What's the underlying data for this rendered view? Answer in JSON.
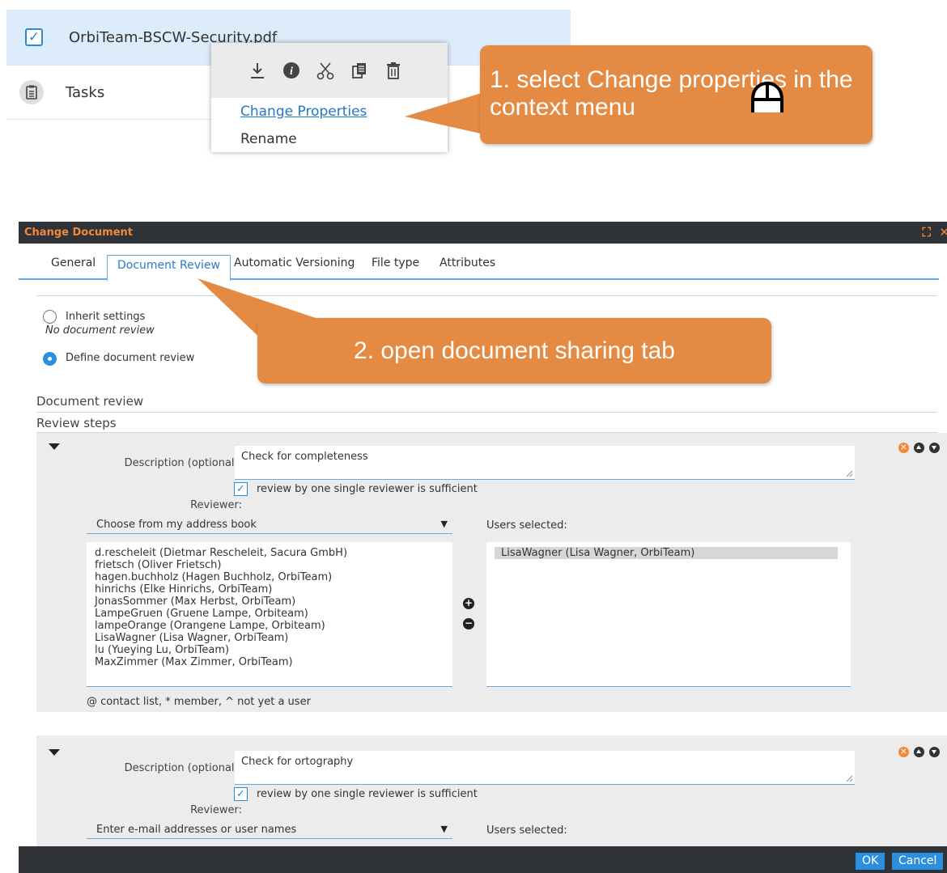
{
  "file_list": {
    "selected_file": "OrbiTeam-BSCW-Security.pdf",
    "second_item": "Tasks"
  },
  "context_menu": {
    "icons": [
      "download-icon",
      "info-icon",
      "cut-icon",
      "copy-icon",
      "trash-icon"
    ],
    "items": [
      "Change Properties",
      "Rename"
    ]
  },
  "callouts": {
    "step1": "1. select Change properties in the context menu",
    "step2": "2. open document sharing tab"
  },
  "dialog": {
    "title": "Change Document",
    "tabs": [
      "General",
      "Document Review",
      "Automatic Versioning",
      "File type",
      "Attributes"
    ],
    "active_tab": "Document Review",
    "inherit_label": "Inherit settings",
    "inherit_sub": "No document review",
    "define_label": "Define document review",
    "section_title": "Document review",
    "steps_title": "Review steps",
    "description_label": "Description (optional):",
    "reviewer_label": "Reviewer:",
    "single_reviewer_label": "review by one single reviewer is sufficient",
    "users_selected_label": "Users selected:",
    "legend": "@ contact list, * member, ^ not yet a user",
    "ok": "OK",
    "cancel": "Cancel"
  },
  "steps": [
    {
      "description": "Check for completeness",
      "single_reviewer": true,
      "reviewer_source": "Choose from my address book",
      "address_book": [
        "d.rescheleit (Dietmar Rescheleit, Sacura GmbH)",
        "frietsch (Oliver Frietsch)",
        "hagen.buchholz (Hagen Buchholz, OrbiTeam)",
        "hinrichs (Elke Hinrichs, OrbiTeam)",
        "JonasSommer (Max Herbst, OrbiTeam)",
        "LampeGruen (Gruene Lampe, Orbiteam)",
        "lampeOrange (Orangene Lampe, Orbiteam)",
        "LisaWagner (Lisa Wagner, OrbiTeam)",
        "lu (Yueying Lu, OrbiTeam)",
        "MaxZimmer (Max Zimmer, OrbiTeam)"
      ],
      "selected_users": [
        "LisaWagner (Lisa Wagner, OrbiTeam)"
      ]
    },
    {
      "description": "Check for ortography",
      "single_reviewer": true,
      "reviewer_source": "Enter e-mail addresses or user names"
    }
  ],
  "colors": {
    "accent": "#2b8fe0",
    "callout": "#e58a43",
    "title_text": "#f0893b",
    "selected_row": "#dcecfb"
  }
}
